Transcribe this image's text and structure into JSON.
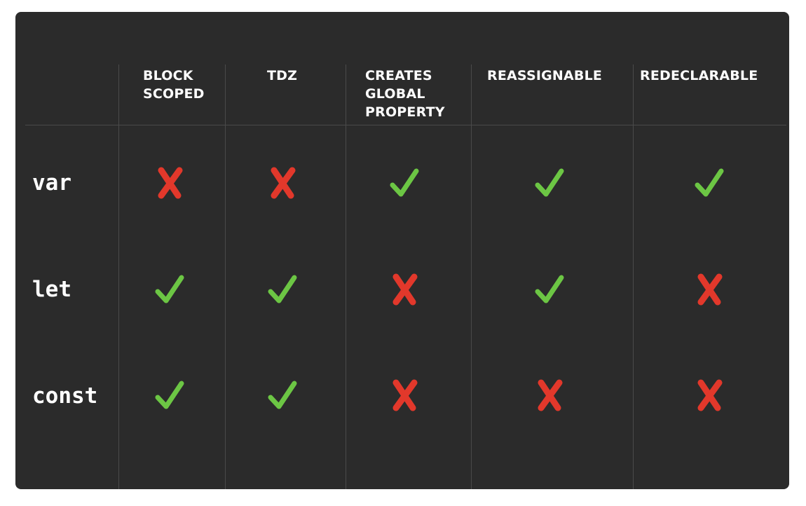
{
  "columns": [
    "BLOCK\nSCOPED",
    "TDZ",
    "CREATES\nGLOBAL\nPROPERTY",
    "REASSIGNABLE",
    "REDECLARABLE"
  ],
  "rows": [
    {
      "label": "var",
      "values": [
        false,
        false,
        true,
        true,
        true
      ]
    },
    {
      "label": "let",
      "values": [
        true,
        true,
        false,
        true,
        false
      ]
    },
    {
      "label": "const",
      "values": [
        true,
        true,
        false,
        false,
        false
      ]
    }
  ],
  "colors": {
    "background": "#2b2b2b",
    "check": "#6cc644",
    "cross": "#e2382b",
    "text": "#ffffff",
    "grid": "#4a4a4a"
  },
  "icons": {
    "true": "check-icon",
    "false": "cross-icon"
  }
}
